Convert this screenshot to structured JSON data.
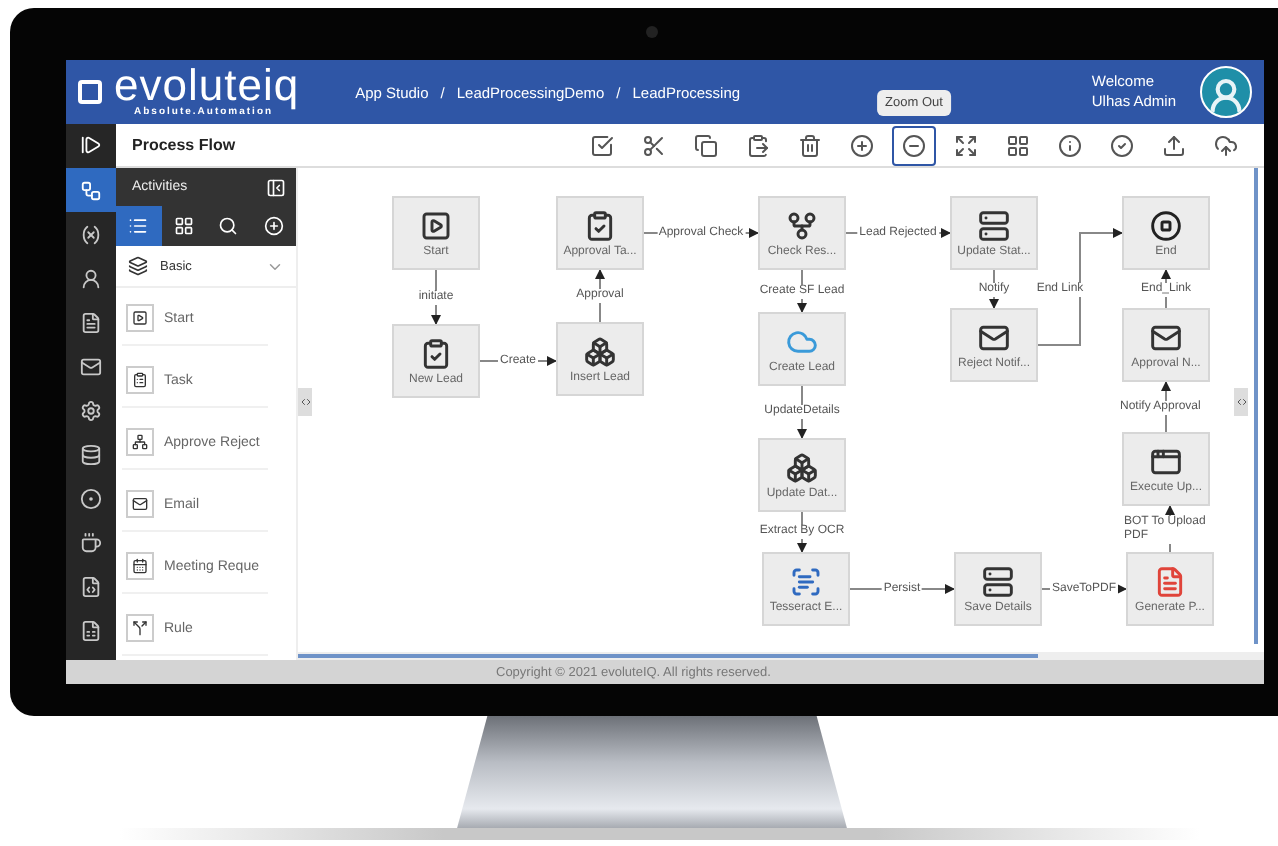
{
  "header": {
    "logo": "evoluteiq",
    "tagline": "Absolute.Automation",
    "separator": "/",
    "breadcrumbs": [
      "App Studio",
      "LeadProcessingDemo",
      "LeadProcessing"
    ],
    "welcome": "Welcome",
    "user": "Ulhas Admin"
  },
  "toolbar": {
    "title": "Process Flow",
    "tooltip": "Zoom Out",
    "buttons": [
      {
        "selected": false
      },
      {
        "selected": false
      },
      {
        "selected": false
      },
      {
        "selected": false
      },
      {
        "selected": false
      },
      {
        "selected": false
      },
      {
        "selected": true
      },
      {
        "selected": false
      },
      {
        "selected": false
      },
      {
        "selected": false
      },
      {
        "selected": false
      },
      {
        "selected": false
      },
      {
        "selected": false
      }
    ]
  },
  "rail": [
    {
      "selected": true
    },
    {
      "selected": false
    },
    {
      "selected": false
    },
    {
      "selected": false
    },
    {
      "selected": false
    },
    {
      "selected": false
    },
    {
      "selected": false
    },
    {
      "selected": false
    },
    {
      "selected": false
    },
    {
      "selected": false
    },
    {
      "selected": false
    }
  ],
  "activities": {
    "title": "Activities",
    "tabs": [
      {
        "selected": true
      },
      {
        "selected": false
      },
      {
        "selected": false
      },
      {
        "selected": false
      }
    ],
    "group": "Basic",
    "items": [
      {
        "label": "Start",
        "kind": "start"
      },
      {
        "label": "Task",
        "kind": "task"
      },
      {
        "label": "Approve Reject",
        "kind": "approve"
      },
      {
        "label": "Email",
        "kind": "email"
      },
      {
        "label": "Meeting Reque",
        "kind": "meeting"
      },
      {
        "label": "Rule",
        "kind": "rule"
      }
    ]
  },
  "flow": {
    "nodes": [
      {
        "label": "Start",
        "kind": "start"
      },
      {
        "label": "Approval Ta...",
        "kind": "task"
      },
      {
        "label": "Check Res...",
        "kind": "gateway"
      },
      {
        "label": "Update Stat...",
        "kind": "server"
      },
      {
        "label": "End",
        "kind": "end"
      },
      {
        "label": "New Lead",
        "kind": "task"
      },
      {
        "label": "Insert Lead",
        "kind": "insert"
      },
      {
        "label": "Create Lead",
        "kind": "cloud"
      },
      {
        "label": "Reject Notif...",
        "kind": "mail"
      },
      {
        "label": "Approval N...",
        "kind": "mail"
      },
      {
        "label": "Update Dat...",
        "kind": "update"
      },
      {
        "label": "Execute Up...",
        "kind": "execute"
      },
      {
        "label": "Tesseract E...",
        "kind": "ocr"
      },
      {
        "label": "Save Details",
        "kind": "server"
      },
      {
        "label": "Generate P...",
        "kind": "pdf"
      }
    ],
    "edges": [
      {
        "label": "Approval Check"
      },
      {
        "label": "Lead Rejected"
      },
      {
        "label": "Create SF Lead"
      },
      {
        "label": "Notify"
      },
      {
        "label": "End Link"
      },
      {
        "label": "End_Link"
      },
      {
        "label": "initiate"
      },
      {
        "label": "Approval"
      },
      {
        "label": "Create"
      },
      {
        "label": "UpdateDetails"
      },
      {
        "label": "Notify Approval"
      },
      {
        "label": "Extract By OCR"
      },
      {
        "label": "BOT To Upload PDF"
      },
      {
        "label": "Persist"
      },
      {
        "label": "SaveToPDF"
      }
    ]
  },
  "footer": "Copyright © 2021 evoluteIQ. All rights reserved."
}
